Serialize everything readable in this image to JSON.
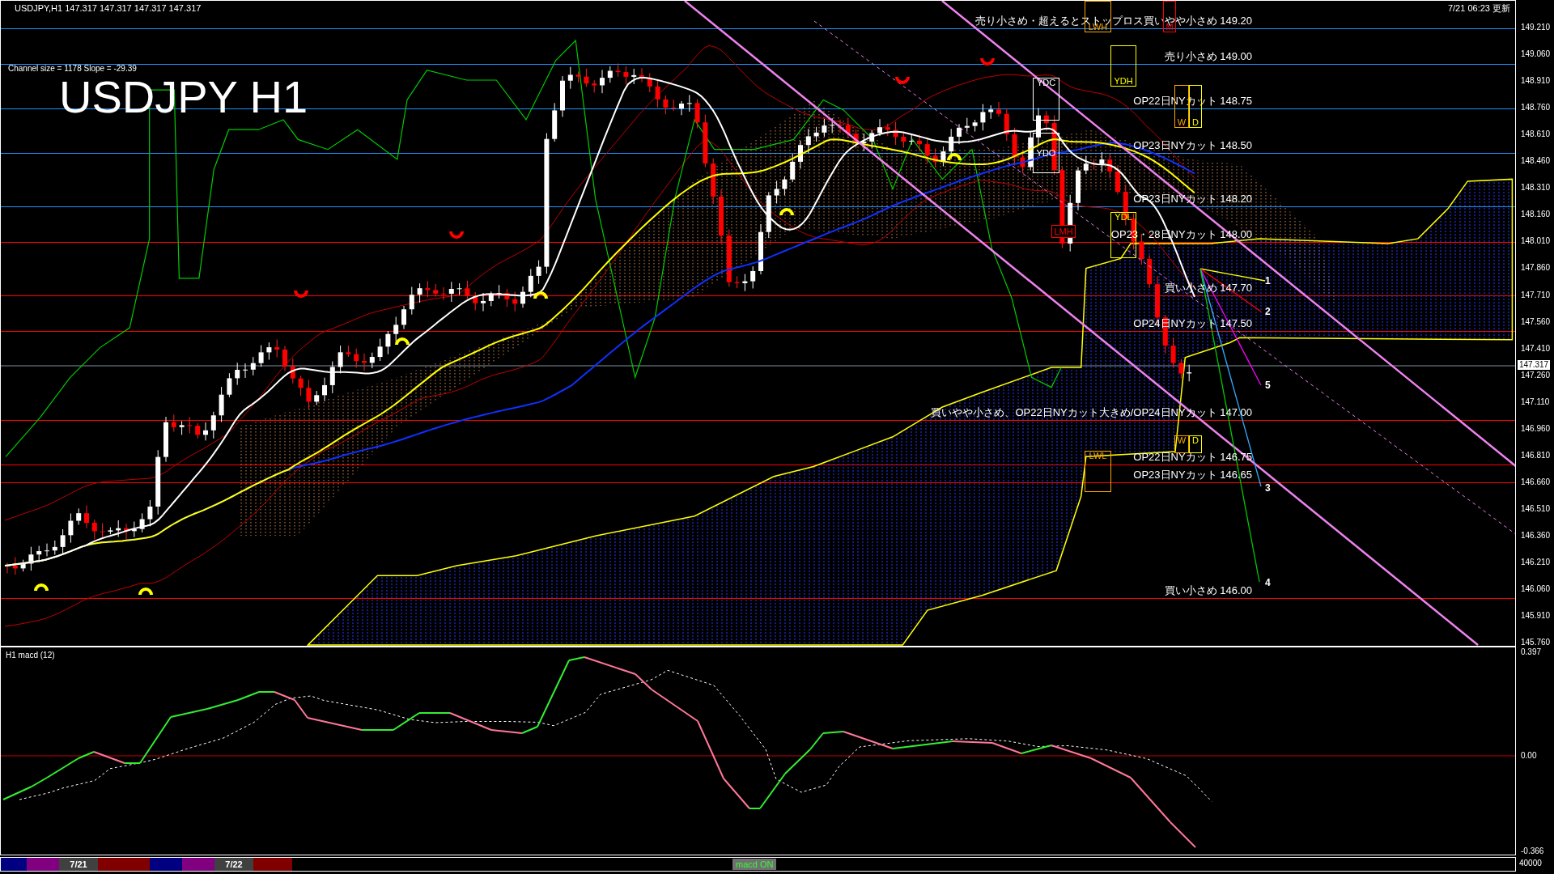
{
  "header": {
    "symbol_info": "USDJPY,H1  147.317 147.317 147.317 147.317",
    "channel_info": "Channel size = 1178 Slope = -29.39",
    "chart_title": "USDJPY H1",
    "updated": "7/21 06:23 更新"
  },
  "levels": [
    {
      "label": "売り小さめ・超えるとストップロス買いやや小さめ 149.20",
      "color": "#1e90ff"
    },
    {
      "label": "売り小さめ 149.00",
      "color": "#1e90ff"
    },
    {
      "label": "OP22日NYカット 148.75",
      "color": "#1e90ff"
    },
    {
      "label": "OP23日NYカット 148.50",
      "color": "#1e90ff"
    },
    {
      "label": "OP23日NYカット 148.20",
      "color": "#1e90ff"
    },
    {
      "label": "OP23・28日NYカット 148.00",
      "color": "#ff0000"
    },
    {
      "label": "買い小さめ 147.70",
      "color": "#ff0000"
    },
    {
      "label": "OP24日NYカット 147.50",
      "color": "#ff0000"
    },
    {
      "label": "買いやや小さめ、OP22日NYカット大きめ/OP24日NYカット 147.00",
      "color": "#ff0000"
    },
    {
      "label": "OP22日NYカット 146.75",
      "color": "#ff0000"
    },
    {
      "label": "OP23日NYカット 146.65",
      "color": "#ff0000"
    },
    {
      "label": "買い小さめ 146.00",
      "color": "#ff0000"
    }
  ],
  "zones": [
    {
      "label": "LWH",
      "color": "#ffa500"
    },
    {
      "label": "M",
      "color": "#ff0000"
    },
    {
      "label": "YDH",
      "color": "#ffff00"
    },
    {
      "label": "YDC",
      "color": "#ffffff"
    },
    {
      "label": "YDO",
      "color": "#ffffff"
    },
    {
      "label": "W",
      "color": "#ffa500"
    },
    {
      "label": "D",
      "color": "#ffff00"
    },
    {
      "label": "YDL",
      "color": "#ffff00"
    },
    {
      "label": "LMH",
      "color": "#ff0000"
    },
    {
      "label": "W",
      "color": "#ffa500"
    },
    {
      "label": "D",
      "color": "#ffff00"
    },
    {
      "label": "LWL",
      "color": "#ffa500"
    }
  ],
  "projection_labels": [
    "1",
    "2",
    "5",
    "3",
    "4"
  ],
  "price_axis": [
    "149.210",
    "149.060",
    "148.910",
    "148.760",
    "148.610",
    "148.460",
    "148.310",
    "148.160",
    "148.010",
    "147.860",
    "147.710",
    "147.560",
    "147.410",
    "147.260",
    "147.110",
    "146.960",
    "146.810",
    "146.660",
    "146.510",
    "146.360",
    "146.210",
    "146.060",
    "145.910",
    "145.760"
  ],
  "current_price": "147.317",
  "macd": {
    "title": "H1 macd (12)",
    "axis": [
      "0.397",
      "0.00",
      "-0.366"
    ]
  },
  "session_bar": {
    "segments": [
      {
        "color": "#000080"
      },
      {
        "color": "#800080"
      },
      {
        "label": "7/21",
        "color": "#404040"
      },
      {
        "color": "#800000"
      },
      {
        "color": "#000080"
      },
      {
        "color": "#800080"
      },
      {
        "label": "7/22",
        "color": "#404040"
      },
      {
        "color": "#800000"
      }
    ],
    "button": "macd ON",
    "volume_axis": "40000"
  }
}
